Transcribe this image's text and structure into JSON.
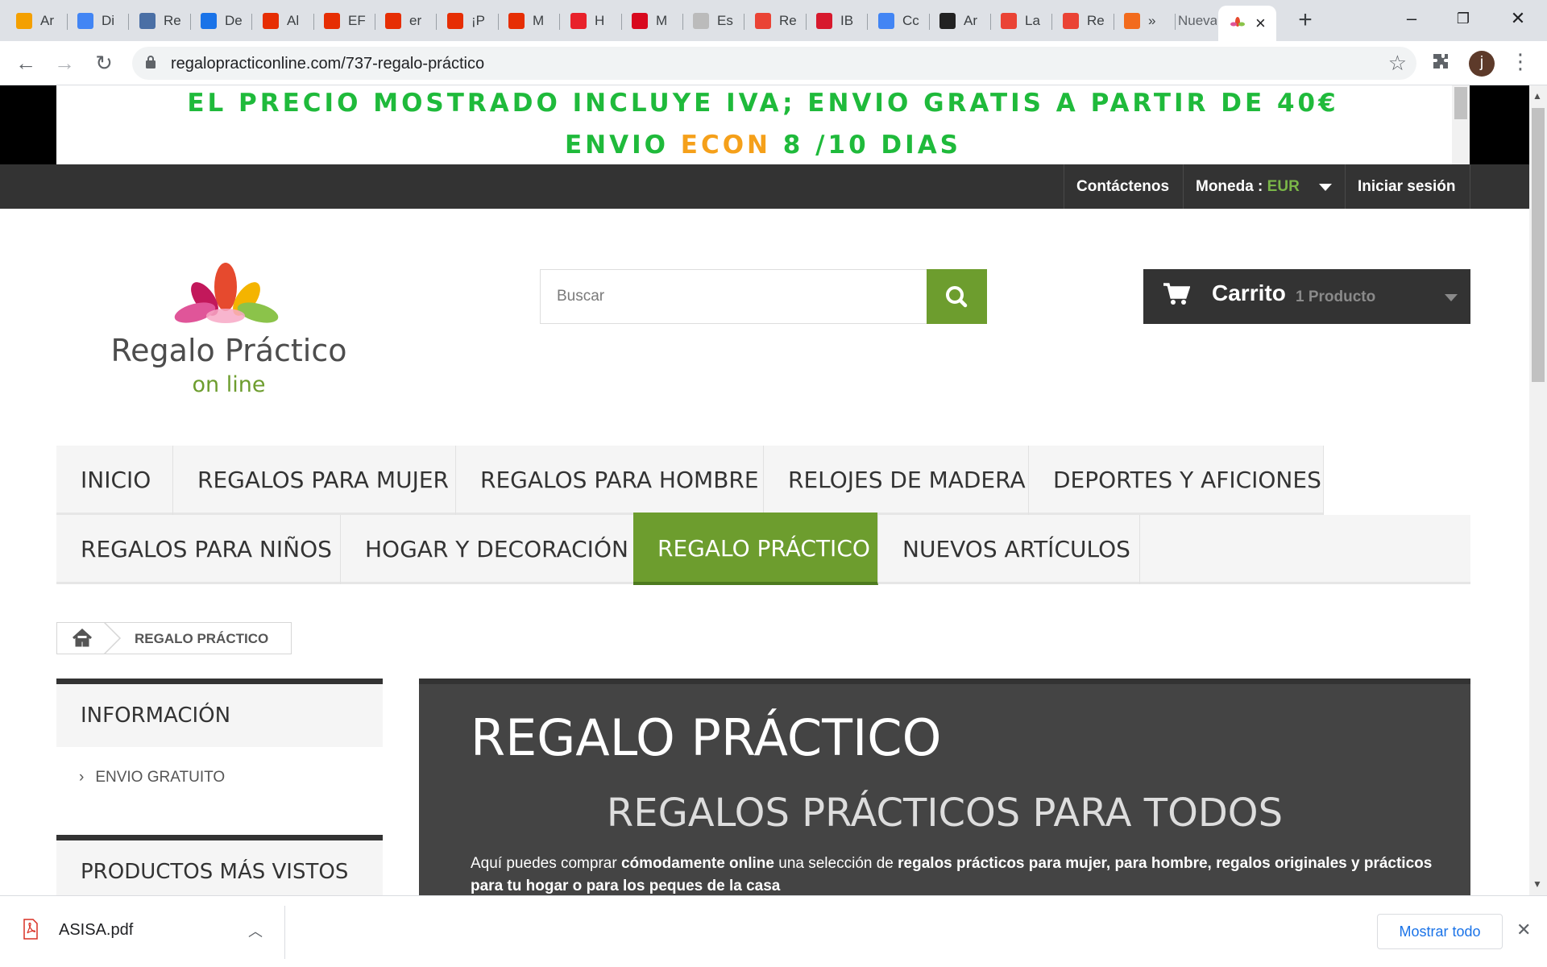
{
  "browser": {
    "tabs": [
      {
        "title": "Ar",
        "color": "#f4a000",
        "icon": "analytics-icon"
      },
      {
        "title": "Di",
        "color": "#4285f4",
        "icon": "heart-icon"
      },
      {
        "title": "Re",
        "color": "#4a6fa5",
        "icon": "people-icon"
      },
      {
        "title": "De",
        "color": "#1a73e8",
        "icon": "download-icon"
      },
      {
        "title": "Al",
        "color": "#e62e04",
        "icon": "aliexpress-icon"
      },
      {
        "title": "EF",
        "color": "#e62e04",
        "icon": "aliexpress-icon"
      },
      {
        "title": "er",
        "color": "#e62e04",
        "icon": "aliexpress-icon"
      },
      {
        "title": "¡P",
        "color": "#e62e04",
        "icon": "aliexpress-icon"
      },
      {
        "title": "M",
        "color": "#e62e04",
        "icon": "aliexpress-icon"
      },
      {
        "title": "H",
        "color": "#e8212b",
        "icon": "h-icon"
      },
      {
        "title": "M",
        "color": "#d8091e",
        "icon": "wallapop-icon"
      },
      {
        "title": "Es",
        "color": "#bbbbbb",
        "icon": "page-icon"
      },
      {
        "title": "Re",
        "color": "#ea4335",
        "icon": "gmail-icon"
      },
      {
        "title": "IB",
        "color": "#d7192d",
        "icon": "iberia-icon"
      },
      {
        "title": "Cc",
        "color": "#4285f4",
        "icon": "google-ads-icon"
      },
      {
        "title": "Ar",
        "color": "#222222",
        "icon": "amazon-icon"
      },
      {
        "title": "La",
        "color": "#ea4335",
        "icon": "gmail-icon"
      },
      {
        "title": "Re",
        "color": "#ea4335",
        "icon": "gmail-icon"
      },
      {
        "title": "»",
        "color": "#f26b1d",
        "icon": "swirl-icon"
      }
    ],
    "newtab_title": "Nueva",
    "url": "regalopracticonline.com/737-regalo-práctico"
  },
  "banner": {
    "line1": "EL PRECIO MOSTRADO INCLUYE IVA; ENVIO GRATIS A PARTIR DE 40€",
    "line2_a": "ENVIO ",
    "line2_highlight": "ECON",
    "line2_b": " 8 /10 DIAS"
  },
  "topnav": {
    "contact": "Contáctenos",
    "currency_label": "Moneda :",
    "currency_value": "EUR",
    "login": "Iniciar sesión"
  },
  "logo": {
    "line1": "Regalo Práctico",
    "line2": "on line"
  },
  "search": {
    "placeholder": "Buscar"
  },
  "cart": {
    "label": "Carrito",
    "count": "1 Producto"
  },
  "menu": {
    "row1": [
      "INICIO",
      "REGALOS PARA MUJER",
      "REGALOS PARA HOMBRE",
      "RELOJES DE MADERA",
      "DEPORTES Y AFICIONES"
    ],
    "row2": [
      "REGALOS PARA NIÑOS",
      "HOGAR Y DECORACIÓN",
      "REGALO PRÁCTICO",
      "NUEVOS ARTÍCULOS"
    ]
  },
  "breadcrumb": {
    "current": "REGALO PRÁCTICO"
  },
  "sidebar": {
    "info_title": "INFORMACIÓN",
    "info_link": "ENVIO GRATUITO",
    "most_viewed_title": "PRODUCTOS MÁS VISTOS"
  },
  "content": {
    "title": "REGALO PRÁCTICO",
    "subtitle": "REGALOS PRÁCTICOS PARA TODOS",
    "p_1": "Aquí puedes comprar ",
    "p_2": "cómodamente online",
    "p_3": " una selección de ",
    "p_4": "regalos prácticos para mujer",
    "p_5": ", ",
    "p_6": "para hombre, regalos originales y prácticos para tu hogar o para los peques de la casa"
  },
  "downloads": {
    "file": "ASISA.pdf",
    "show_all": "Mostrar todo"
  },
  "colors": {
    "accent_green": "#6d9d2e",
    "banner_green": "#1fba3b",
    "banner_orange": "#f5a01a",
    "dark": "#333333"
  }
}
